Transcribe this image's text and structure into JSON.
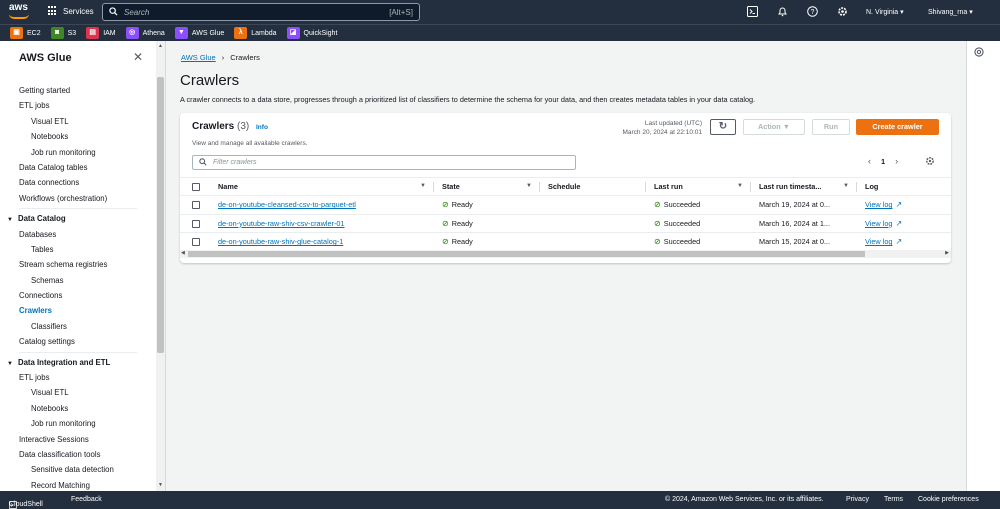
{
  "topbar": {
    "logo": "aws",
    "services_label": "Services",
    "search_placeholder": "Search",
    "search_shortcut": "[Alt+S]",
    "region": "N. Virginia ▾",
    "user": "Shivang_rna ▾"
  },
  "favorites": [
    {
      "label": "EC2",
      "color": "#ec7211",
      "icon": "ec2-icon"
    },
    {
      "label": "S3",
      "color": "#3f8624",
      "icon": "s3-icon"
    },
    {
      "label": "IAM",
      "color": "#dd344c",
      "icon": "iam-icon"
    },
    {
      "label": "Athena",
      "color": "#8c4fff",
      "icon": "athena-icon"
    },
    {
      "label": "AWS Glue",
      "color": "#8c4fff",
      "icon": "glue-icon"
    },
    {
      "label": "Lambda",
      "color": "#ec7211",
      "icon": "lambda-icon"
    },
    {
      "label": "QuickSight",
      "color": "#8c4fff",
      "icon": "quicksight-icon"
    }
  ],
  "sidebar": {
    "title": "AWS Glue",
    "items": [
      {
        "label": "Getting started",
        "kind": "item"
      },
      {
        "label": "ETL jobs",
        "kind": "item"
      },
      {
        "label": "Visual ETL",
        "kind": "sub"
      },
      {
        "label": "Notebooks",
        "kind": "sub"
      },
      {
        "label": "Job run monitoring",
        "kind": "sub"
      },
      {
        "label": "Data Catalog tables",
        "kind": "item"
      },
      {
        "label": "Data connections",
        "kind": "item"
      },
      {
        "label": "Workflows (orchestration)",
        "kind": "item"
      },
      {
        "label": "Data Catalog",
        "kind": "section"
      },
      {
        "label": "Databases",
        "kind": "item"
      },
      {
        "label": "Tables",
        "kind": "sub"
      },
      {
        "label": "Stream schema registries",
        "kind": "item"
      },
      {
        "label": "Schemas",
        "kind": "sub"
      },
      {
        "label": "Connections",
        "kind": "item"
      },
      {
        "label": "Crawlers",
        "kind": "active"
      },
      {
        "label": "Classifiers",
        "kind": "sub"
      },
      {
        "label": "Catalog settings",
        "kind": "item"
      },
      {
        "label": "Data Integration and ETL",
        "kind": "section"
      },
      {
        "label": "ETL jobs",
        "kind": "item"
      },
      {
        "label": "Visual ETL",
        "kind": "sub"
      },
      {
        "label": "Notebooks",
        "kind": "sub"
      },
      {
        "label": "Job run monitoring",
        "kind": "sub"
      },
      {
        "label": "Interactive Sessions",
        "kind": "item"
      },
      {
        "label": "Data classification tools",
        "kind": "item"
      },
      {
        "label": "Sensitive data detection",
        "kind": "sub"
      },
      {
        "label": "Record Matching",
        "kind": "sub"
      }
    ]
  },
  "breadcrumb": {
    "root": "AWS Glue",
    "current": "Crawlers"
  },
  "page": {
    "title": "Crawlers",
    "description": "A crawler connects to a data store, progresses through a prioritized list of classifiers to determine the schema for your data, and then creates metadata tables in your data catalog."
  },
  "panel": {
    "title": "Crawlers",
    "count": "(3)",
    "info": "Info",
    "subtitle": "View and manage all available crawlers.",
    "last_updated_label": "Last updated (UTC)",
    "last_updated_value": "March 20, 2024 at 22:10:01",
    "action_label": "Action ▼",
    "run_label": "Run",
    "create_label": "Create crawler",
    "filter_placeholder": "Filter crawlers",
    "page_number": "1"
  },
  "table": {
    "columns": [
      "Name",
      "State",
      "Schedule",
      "Last run",
      "Last run timesta...",
      "Log"
    ],
    "rows": [
      {
        "name": "de-on-youtube-cleansed-csv-to-parquet-etl",
        "state": "Ready",
        "schedule": "",
        "last_run": "Succeeded",
        "timestamp": "March 19, 2024 at 0...",
        "log": "View log"
      },
      {
        "name": "de-on-youtube-raw-shiv-csv-crawler-01",
        "state": "Ready",
        "schedule": "",
        "last_run": "Succeeded",
        "timestamp": "March 16, 2024 at 1...",
        "log": "View log"
      },
      {
        "name": "de-on-youtube-raw-shiv-glue-catalog-1",
        "state": "Ready",
        "schedule": "",
        "last_run": "Succeeded",
        "timestamp": "March 15, 2024 at 0...",
        "log": "View log"
      }
    ]
  },
  "footer": {
    "cloudshell": "CloudShell",
    "feedback": "Feedback",
    "copyright": "© 2024, Amazon Web Services, Inc. or its affiliates.",
    "privacy": "Privacy",
    "terms": "Terms",
    "cookies": "Cookie preferences"
  }
}
